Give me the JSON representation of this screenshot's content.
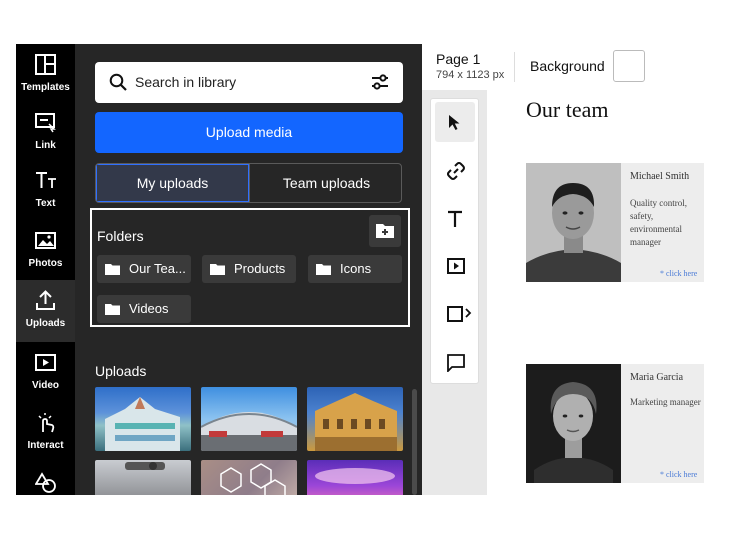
{
  "rail": {
    "items": [
      {
        "label": "Templates",
        "icon": "templates-icon"
      },
      {
        "label": "Link",
        "icon": "link-frame-icon"
      },
      {
        "label": "Text",
        "icon": "text-icon"
      },
      {
        "label": "Photos",
        "icon": "photos-icon"
      },
      {
        "label": "Uploads",
        "icon": "uploads-icon",
        "active": true
      },
      {
        "label": "Video",
        "icon": "video-icon"
      },
      {
        "label": "Interact",
        "icon": "interact-icon"
      },
      {
        "label": "",
        "icon": "shapes-icon"
      }
    ]
  },
  "library": {
    "search_placeholder": "Search in library",
    "upload_label": "Upload media",
    "tabs": {
      "my": "My uploads",
      "team": "Team uploads"
    },
    "folders_title": "Folders",
    "folders": [
      "Our Tea...",
      "Products",
      "Icons",
      "Videos"
    ],
    "uploads_title": "Uploads",
    "uploads": [
      "colorful-facade-photo",
      "stadium-photo",
      "yellow-building-photo",
      "street-photo",
      "hexagon-collage-photo",
      "purple-light-photo"
    ]
  },
  "editor": {
    "page_name": "Page 1",
    "page_size": "794 x 1123 px",
    "background_label": "Background"
  },
  "document": {
    "title": "Our team",
    "members": [
      {
        "name": "Michael Smith",
        "description": "Quality control, safety, environmental manager",
        "link": "* click here"
      },
      {
        "name": "Maria Garcia",
        "description": "Marketing manager",
        "link": "* click here"
      }
    ]
  },
  "colors": {
    "accent": "#1366ff",
    "panel": "#262626",
    "rail": "#000000"
  }
}
